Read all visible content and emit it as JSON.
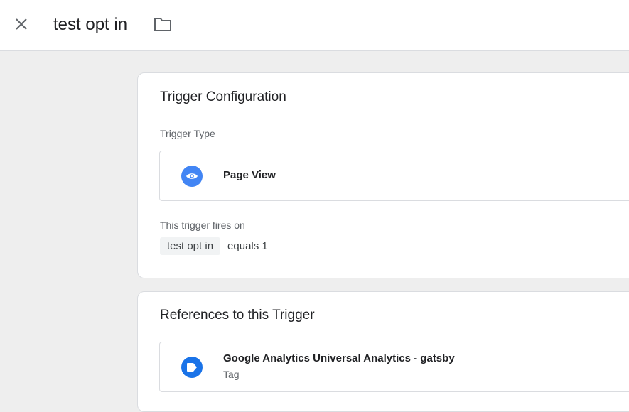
{
  "header": {
    "title_value": "test opt in",
    "close_icon": "close-icon",
    "folder_icon": "folder-icon"
  },
  "trigger_config": {
    "title": "Trigger Configuration",
    "type_label": "Trigger Type",
    "type_name": "Page View",
    "type_icon": "eye-icon",
    "fires_label": "This trigger fires on",
    "condition": {
      "variable": "test opt in",
      "operator_value": "equals 1"
    }
  },
  "references": {
    "title": "References to this Trigger",
    "items": [
      {
        "name": "Google Analytics Universal Analytics - gatsby",
        "type": "Tag",
        "icon": "tag-icon"
      }
    ]
  },
  "colors": {
    "accent": "#4285f4",
    "tag_blue": "#1a73e8",
    "background": "#eeeeee"
  }
}
